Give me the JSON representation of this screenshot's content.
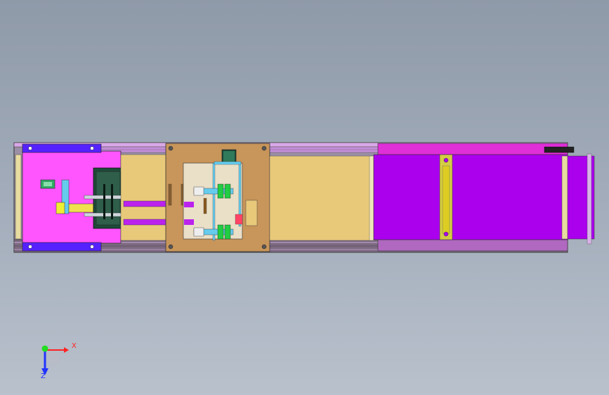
{
  "viewport": {
    "background_top": "#8f9aa9",
    "background_bottom": "#b9c1cc"
  },
  "model": {
    "frame_color": "#9b8fa6",
    "rail_pink": "#d9a8e8",
    "rail_dark": "#6a5a6e",
    "infeed_plate_color": "#ff55ff",
    "infeed_bracket_color": "#5522ff",
    "bed_color": "#e8c97a",
    "carriage_plate_color": "#c8955a",
    "conveyor_belt_color": "#aa00ee",
    "conveyor_frame_color": "#e02ed8",
    "guide_color": "#d4cc44",
    "green_part_color": "#22cc44",
    "cyan_part_color": "#66ccee",
    "black_part_color": "#222222"
  },
  "triad": {
    "x_label": "X",
    "z_label": "Z",
    "x_color": "#ff2222",
    "y_color": "#22dd22",
    "z_color": "#2233ff"
  }
}
